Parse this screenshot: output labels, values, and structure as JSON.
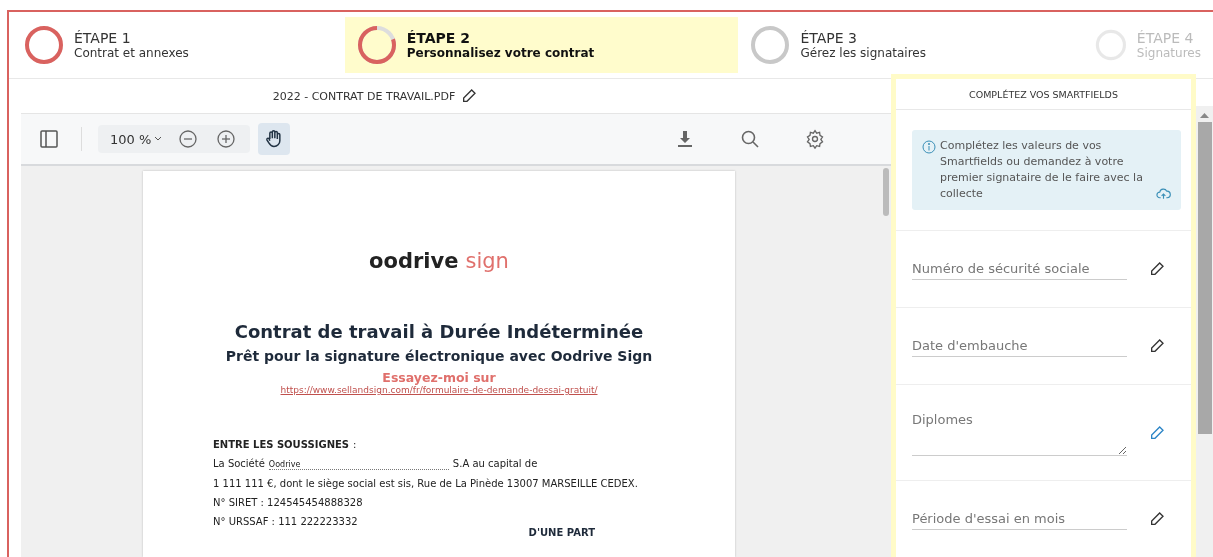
{
  "steps": [
    {
      "label": "ÉTAPE 1",
      "subtitle": "Contrat et annexes",
      "kind": "done",
      "selected": false,
      "disabled": false
    },
    {
      "label": "ÉTAPE 2",
      "subtitle": "Personnalisez votre contrat",
      "kind": "current",
      "selected": true,
      "disabled": false
    },
    {
      "label": "ÉTAPE 3",
      "subtitle": "Gérez les signataires",
      "kind": "todo",
      "selected": false,
      "disabled": false
    },
    {
      "label": "ÉTAPE 4",
      "subtitle": "Signatures",
      "kind": "todo",
      "selected": false,
      "disabled": true
    }
  ],
  "file_name": "2022 - CONTRAT DE TRAVAIL.PDF",
  "toolbar": {
    "zoom": "100 %",
    "hand_tool_selected": true
  },
  "document": {
    "logo_main": "oodrive",
    "logo_accent": "sign",
    "title": "Contrat de travail à Durée Indéterminée",
    "subtitle": "Prêt pour la signature électronique avec Oodrive Sign",
    "cta": "Essayez-moi sur",
    "link": "https://www.sellandsign.com/fr/formulaire-de-demande-dessai-gratuit/",
    "section": "ENTRE LES SOUSSIGNES",
    "section_suffix": ":",
    "company_prefix": "La Société",
    "company_value": "Oodrive",
    "company_suffix": "S.A au capital de",
    "lines": [
      "1 111 111 €, dont le siège social est sis, Rue de La Pinède 13007 MARSEILLE CEDEX.",
      "N° SIRET : 124545454888328",
      "N° URSSAF : 111 222223332"
    ],
    "party": "D'UNE PART"
  },
  "panel": {
    "title": "COMPLÉTEZ VOS SMARTFIELDS",
    "info": "Complétez les valeurs de vos Smartfields ou demandez à votre premier signataire de le faire avec la collecte",
    "fields": [
      {
        "placeholder": "Numéro de sécurité sociale",
        "kind": "input",
        "active": false
      },
      {
        "placeholder": "Date d'embauche",
        "kind": "input",
        "active": false
      },
      {
        "placeholder": "Diplomes",
        "kind": "textarea",
        "active": true
      },
      {
        "placeholder": "Période d'essai en mois",
        "kind": "input",
        "active": false
      }
    ]
  }
}
